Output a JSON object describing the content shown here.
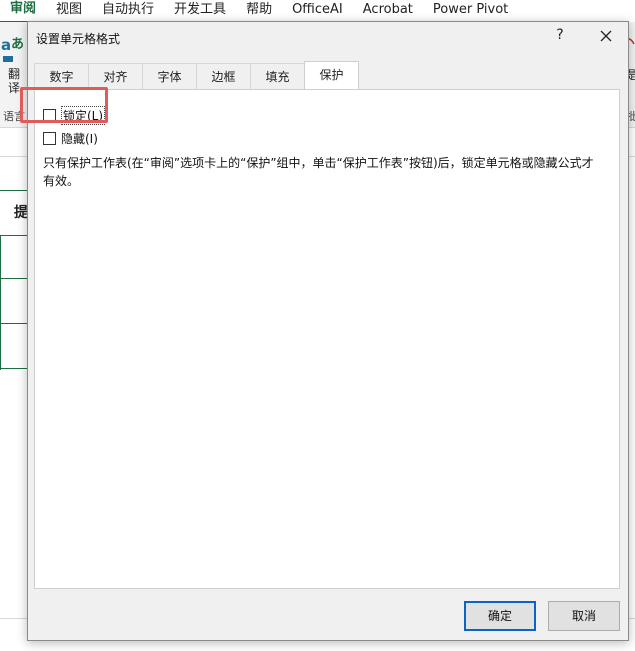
{
  "ribbon": {
    "tabs": [
      "审阅",
      "视图",
      "自动执行",
      "开发工具",
      "帮助",
      "OfficeAI",
      "Acrobat",
      "Power Pivot"
    ],
    "active_tab_index": 0,
    "translate_label_1": "翻",
    "translate_label_2": "译",
    "language_group": "语言",
    "right_fragment": "提",
    "right_group_fragment": "批"
  },
  "sheet": {
    "header_fragment": "提"
  },
  "dialog": {
    "title": "设置单元格格式",
    "help_glyph": "?",
    "tabs": [
      "数字",
      "对齐",
      "字体",
      "边框",
      "填充",
      "保护"
    ],
    "active_tab": "保护",
    "checkboxes": {
      "locked_label": "锁定(L)",
      "hidden_label": "隐藏(I)"
    },
    "info_text": "只有保护工作表(在“审阅”选项卡上的“保护”组中，单击“保护工作表”按钮)后，锁定单元格或隐藏公式才有效。",
    "ok_label": "确定",
    "cancel_label": "取消"
  },
  "colors": {
    "excel_green": "#1e6e42",
    "highlight_red": "#e15b5b",
    "ok_border_blue": "#0a64c8"
  }
}
